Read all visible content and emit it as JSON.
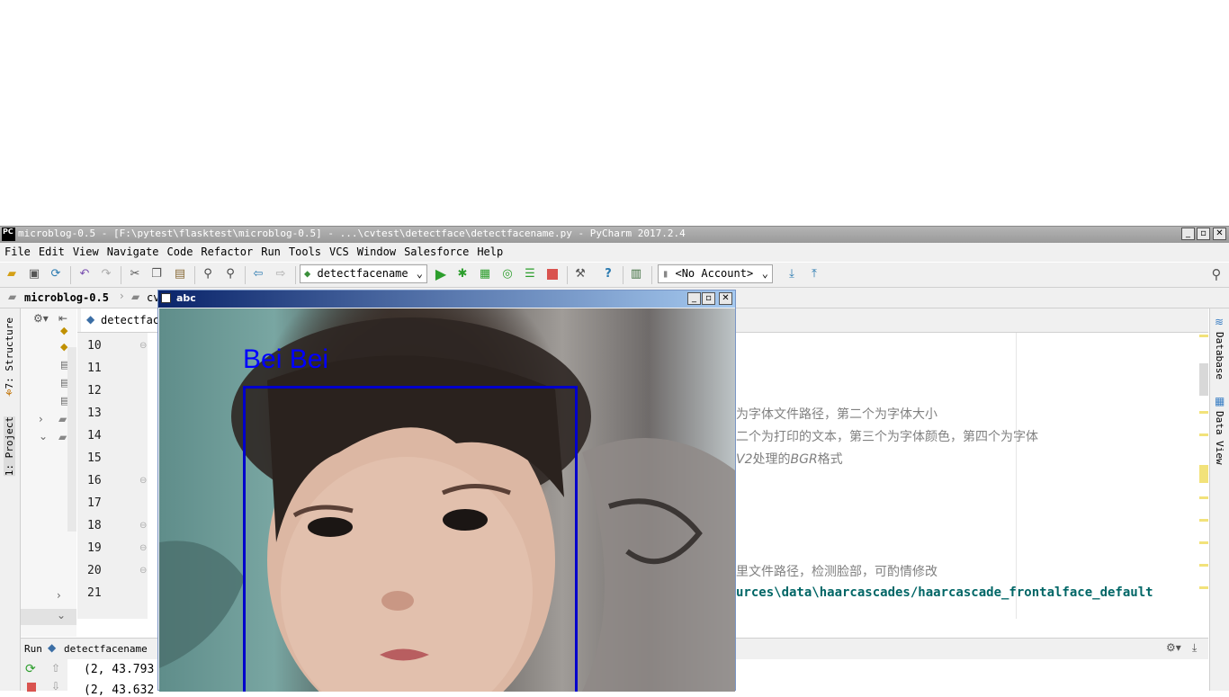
{
  "window": {
    "title": "microblog-0.5 - [F:\\pytest\\flasktest\\microblog-0.5] - ...\\cvtest\\detectface\\detectfacename.py - PyCharm 2017.2.4",
    "app_icon": "PC"
  },
  "menu": [
    "File",
    "Edit",
    "View",
    "Navigate",
    "Code",
    "Refactor",
    "Run",
    "Tools",
    "VCS",
    "Window",
    "Salesforce",
    "Help"
  ],
  "toolbar": {
    "run_config": "detectfacename",
    "account": "<No Account>"
  },
  "navbar": {
    "project": "microblog-0.5",
    "next_crumb": "cv"
  },
  "left_strip": {
    "structure_label": "7: Structure",
    "project_label": "1: Project"
  },
  "right_strip": {
    "database_label": "Database",
    "dataview_label": "Data View"
  },
  "editor": {
    "tab_label": "detectfac",
    "line_numbers": [
      "10",
      "11",
      "12",
      "13",
      "14",
      "15",
      "16",
      "17",
      "18",
      "19",
      "20",
      "21"
    ],
    "visible_code": {
      "line13": "为字体文件路径，第二个为字体大小",
      "line14": "二个为打印的文本，第三个为字体颜色，第四个为字体",
      "line15_a": "V2",
      "line15_b": "处理的",
      "line15_c": "BGR",
      "line15_d": "格式",
      "line20": "里文件路径，检测脸部，可酌情修改",
      "line21": "urces\\data\\haarcascades/haarcascade_frontalface_default"
    }
  },
  "run_panel": {
    "tab_label": "Run",
    "config_name": "detectfacename",
    "output_line1": "(2, 43.793",
    "output_line2": "(2, 43.632"
  },
  "abc_window": {
    "title": "abc",
    "face_label": "Bei Bei",
    "label_color": "#0000ff",
    "box_color": "#0000cc"
  },
  "colors": {
    "run_green": "#2c9e2c",
    "stop_red": "#d9534f",
    "code_teal": "#006666",
    "comment_gray": "#808080"
  }
}
